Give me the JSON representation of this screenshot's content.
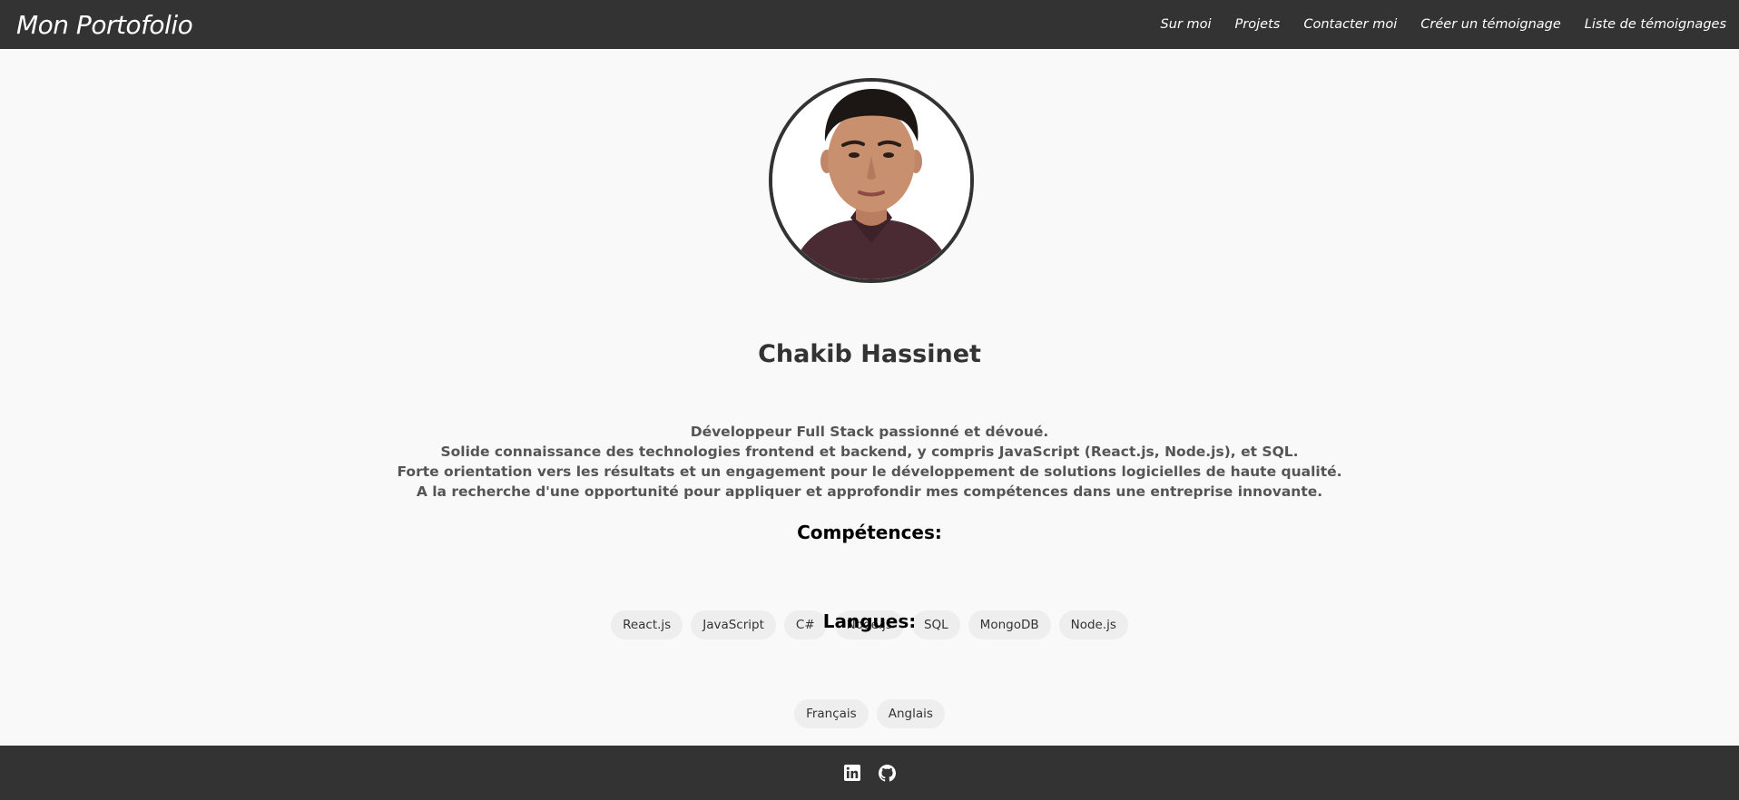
{
  "navbar": {
    "brand": "Mon Portofolio",
    "links": [
      {
        "label": "Sur moi"
      },
      {
        "label": "Projets"
      },
      {
        "label": "Contacter moi"
      },
      {
        "label": "Créer un témoignage"
      },
      {
        "label": "Liste de témoignages"
      }
    ]
  },
  "profile": {
    "name": "Chakib Hassinet",
    "bio": [
      "Développeur Full Stack passionné et dévoué.",
      "Solide connaissance des technologies frontend et backend, y compris JavaScript (React.js, Node.js), et SQL.",
      "Forte orientation vers les résultats et un engagement pour le développement de solutions logicielles de haute qualité.",
      "A la recherche d'une opportunité pour appliquer et approfondir mes compétences dans une entreprise innovante."
    ]
  },
  "skills": {
    "title": "Compétences:",
    "items": [
      "React.js",
      "JavaScript",
      "C#",
      "Node.js",
      "SQL",
      "MongoDB",
      "Node.js"
    ]
  },
  "languages": {
    "title": "Langues:",
    "items": [
      "Français",
      "Anglais"
    ]
  },
  "footer": {
    "icons": [
      "linkedin-icon",
      "github-icon"
    ]
  },
  "colors": {
    "navbar_bg": "#333333",
    "page_bg": "#f9f9f9",
    "tag_bg": "#eeeeee",
    "text_dark": "#333333"
  }
}
